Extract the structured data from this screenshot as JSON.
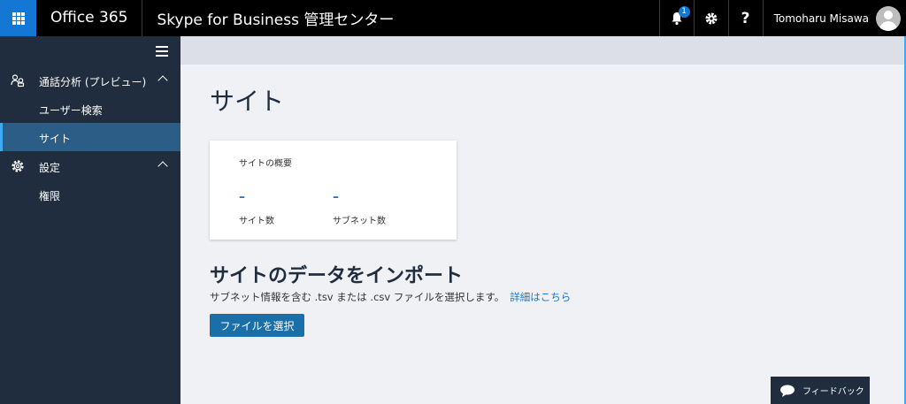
{
  "header": {
    "brand": "Office 365",
    "app_title": "Skype for Business 管理センター",
    "notification_count": "1",
    "help_label": "?",
    "user_name": "Tomoharu Misawa"
  },
  "sidebar": {
    "groups": [
      {
        "label": "通話分析 (プレビュー)",
        "icon": "people-icon",
        "items": [
          "ユーザー検索",
          "サイト"
        ]
      },
      {
        "label": "設定",
        "icon": "gear-icon",
        "items": [
          "権限"
        ]
      }
    ],
    "active_item": "サイト"
  },
  "main": {
    "page_title": "サイト",
    "summary_card": {
      "title": "サイトの概要",
      "metrics": [
        {
          "value": "–",
          "label": "サイト数"
        },
        {
          "value": "–",
          "label": "サブネット数"
        }
      ]
    },
    "import_section": {
      "title": "サイトのデータをインポート",
      "description": "サブネット情報を含む .tsv または .csv ファイルを選択します。",
      "link": "詳細はこちら",
      "button": "ファイルを選択"
    },
    "feedback_label": "フィードバック"
  },
  "colors": {
    "accent": "#1477d4",
    "sidebar_bg": "#1f2d3e",
    "active_item_bg": "#2c5d86"
  }
}
